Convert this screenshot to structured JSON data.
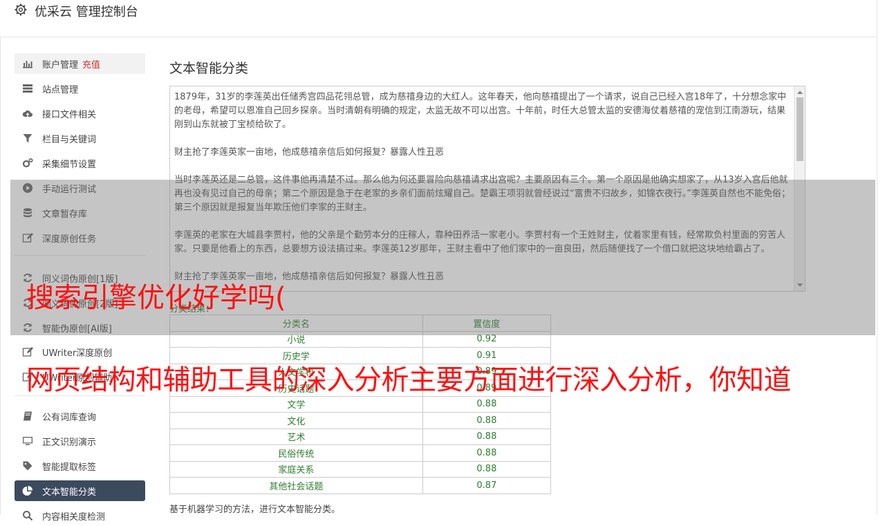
{
  "app": {
    "title": "优采云 管理控制台"
  },
  "sidebar": {
    "items": [
      {
        "label": "账户管理",
        "highlight": "充值",
        "icon": "bar-chart-icon"
      },
      {
        "label": "站点管理",
        "icon": "server-icon"
      },
      {
        "label": "接口文件相关",
        "icon": "cloud-upload-icon"
      },
      {
        "label": "栏目与关键词",
        "icon": "filter-icon"
      },
      {
        "label": "采集细节设置",
        "icon": "cogs-icon"
      },
      {
        "label": "手动运行测试",
        "icon": "play-icon"
      },
      {
        "label": "文章暂存库",
        "icon": "database-icon"
      },
      {
        "label": "深度原创任务",
        "icon": "edit-icon"
      },
      {
        "label": "同义词伪原创[1版]",
        "icon": "refresh-icon"
      },
      {
        "label": "同义词伪原创[2版]",
        "icon": "refresh-icon"
      },
      {
        "label": "智能伪原创[AI版]",
        "icon": "refresh-icon"
      },
      {
        "label": "UWriter深度原创",
        "icon": "edit-icon"
      },
      {
        "label": "UWriter原创辅助",
        "icon": "edit-icon"
      },
      {
        "label": "公有词库查询",
        "icon": "book-icon"
      },
      {
        "label": "正文识别演示",
        "icon": "monitor-icon"
      },
      {
        "label": "智能提取标签",
        "icon": "tag-icon"
      },
      {
        "label": "文本智能分类",
        "icon": "pie-chart-icon"
      },
      {
        "label": "内容相关度检测",
        "icon": "search-icon"
      }
    ]
  },
  "main": {
    "title": "文本智能分类",
    "paragraphs": [
      "1879年，31岁的李莲英出任储秀宫四品花翎总管，成为慈禧身边的大红人。这年春天，他向慈禧提出了一个请求，说自己已经入宫18年了，十分想念家中的老母，希望可以恩准自己回乡探亲。当时清朝有明确的规定，太监无故不可以出宫。十年前，时任大总管太监的安德海仗着慈禧的宠信到江南游玩，结果刚到山东就被丁宝桢给砍了。",
      "财主抢了李莲英家一亩地，他成慈禧亲信后如何报复？暴露人性丑恶",
      "当时李莲英还是二总管，这件事他再清楚不过。那么他为何还要冒险向慈禧请求出宫呢？主要原因有三个。第一个原因是他确实想家了，从13岁入宫后他就再也没有见过自己的母亲；第二个原因是急于在老家的乡亲们面前炫耀自己。楚霸王项羽就曾经说过“富贵不归故乡，如锦衣夜行。”李莲英自然也不能免俗；第三个原因就是报复当年欺压他们李家的王财主。",
      "李莲英的老家在大城县李贾村，他的父亲是个勤劳本分的庄稼人，靠种田养活一家老小。李贾村有一个王姓财主，仗着家里有钱，经常欺负村里面的穷苦人家。只要是他看上的东西，总要想方设法搞过来。李莲英12岁那年，王财主看中了他们家中的一亩良田，然后随便找了一个借口就把这块地给霸占了。",
      "财主抢了李莲英家一亩地，他成慈禧亲信后如何报复？暴露人性丑恶"
    ],
    "result_label": "分类结果：",
    "table": {
      "headers": [
        "分类名",
        "置信度"
      ],
      "rows": [
        [
          "小说",
          "0.92"
        ],
        [
          "历史学",
          "0.91"
        ],
        [
          "人文学科",
          "0.89"
        ],
        [
          "历史话题",
          "0.89"
        ],
        [
          "文学",
          "0.88"
        ],
        [
          "文化",
          "0.88"
        ],
        [
          "艺术",
          "0.88"
        ],
        [
          "民俗传统",
          "0.88"
        ],
        [
          "家庭关系",
          "0.88"
        ],
        [
          "其他社会话题",
          "0.87"
        ]
      ]
    },
    "footer": "基于机器学习的方法，进行文本智能分类。"
  },
  "overlay": {
    "line1": "搜索引擎优化好学吗(",
    "line2": "网页结构和辅助工具的深入分析主要方面进行深入分析，你知道"
  },
  "colors": {
    "accent_red": "#d32f2f",
    "result_green": "#2e7d32",
    "active_bg": "#3c4a5e",
    "overlay_text": "#ff1010"
  }
}
